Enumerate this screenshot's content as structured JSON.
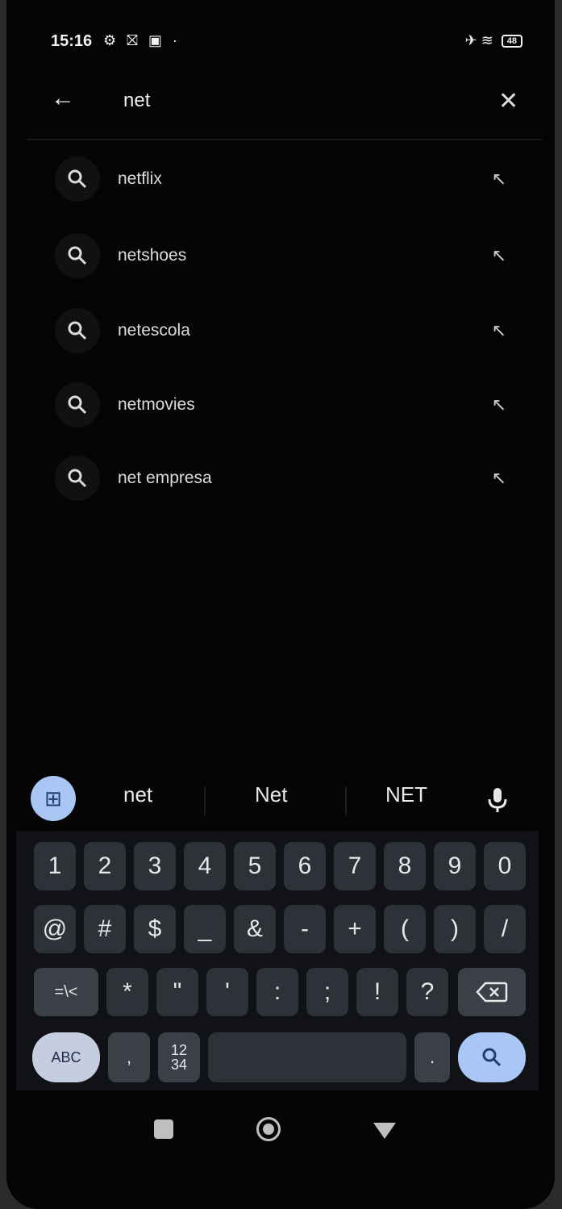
{
  "status_bar": {
    "time": "15:16",
    "left_icons": "⚙ ⛝ ▣ ·",
    "right_icons": "✈ ≋",
    "battery": "48"
  },
  "search": {
    "query": "net",
    "back_icon": "arrow-left-icon",
    "clear_icon": "close-icon"
  },
  "suggestions": [
    {
      "text": "netflix"
    },
    {
      "text": "netshoes"
    },
    {
      "text": "netescola"
    },
    {
      "text": "netmovies"
    },
    {
      "text": "net empresa"
    }
  ],
  "keyboard_suggestions": {
    "words": [
      "net",
      "Net",
      "NET"
    ]
  },
  "keyboard": {
    "row1": [
      "1",
      "2",
      "3",
      "4",
      "5",
      "6",
      "7",
      "8",
      "9",
      "0"
    ],
    "row2": [
      "@",
      "#",
      "$",
      "_",
      "&",
      "-",
      "+",
      "(",
      ")",
      "/"
    ],
    "row3_left": "=\\<",
    "row3": [
      "*",
      "\"",
      "'",
      ":",
      ";",
      "!",
      "?"
    ],
    "row4_abc": "ABC",
    "row4_comma": ",",
    "row4_num_top": "12",
    "row4_num_bottom": "34",
    "row4_period": "."
  },
  "colors": {
    "accent": "#a9c6f5",
    "background": "#050505",
    "key": "#2d3138"
  }
}
